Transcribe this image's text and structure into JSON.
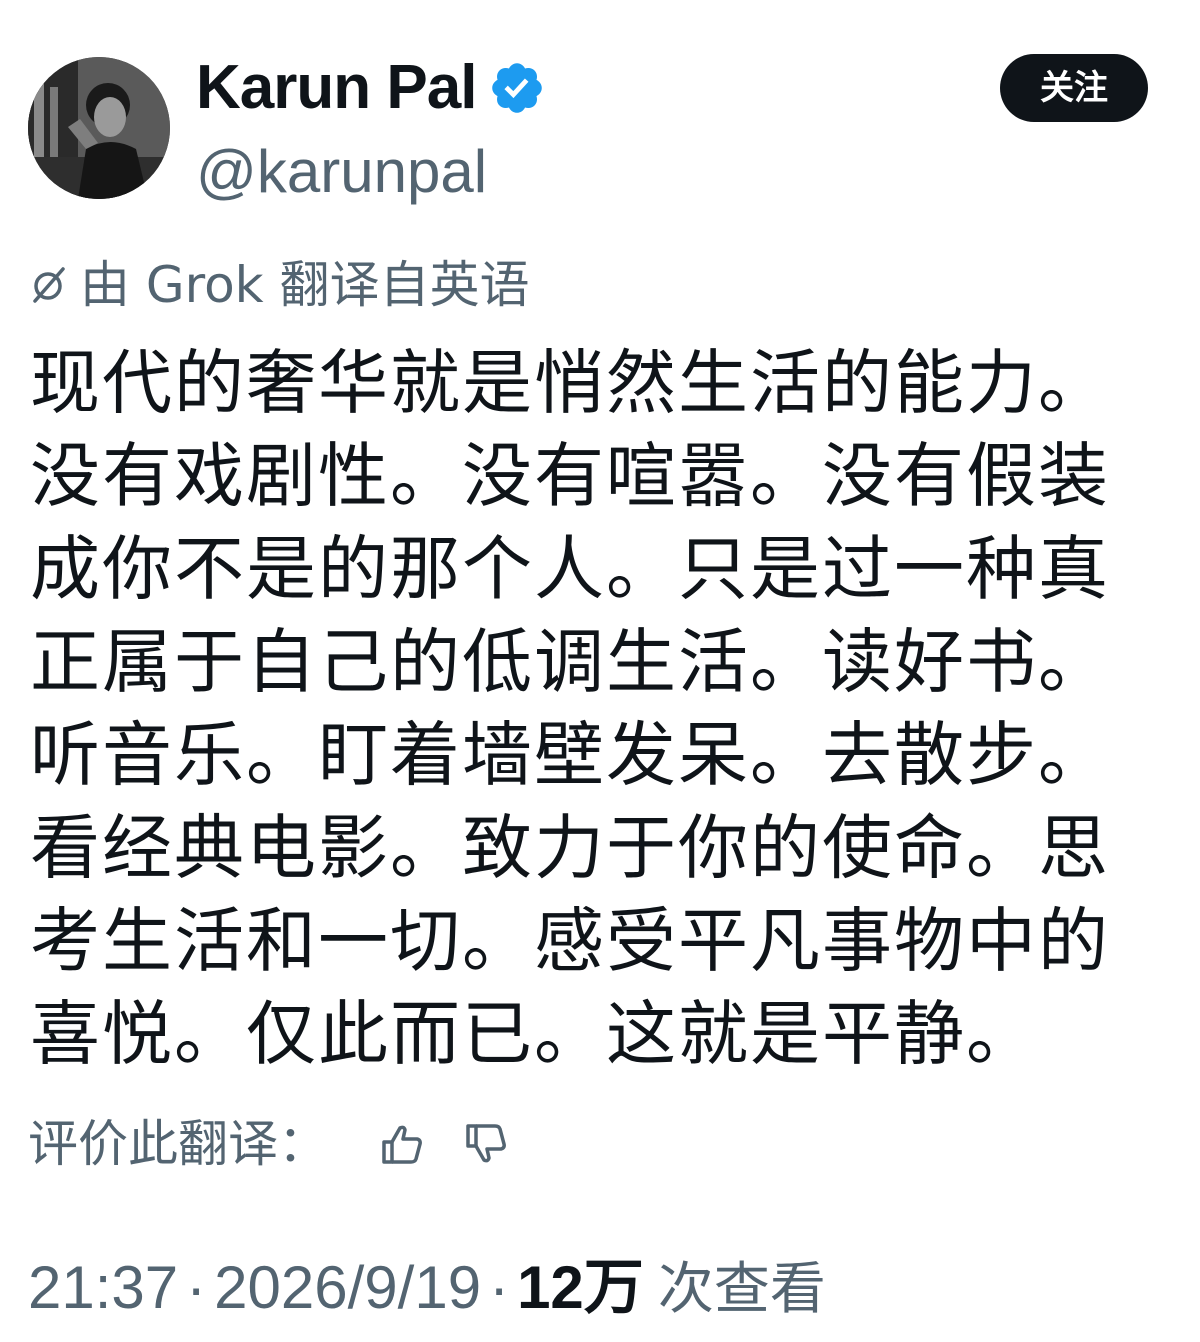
{
  "user": {
    "display_name": "Karun Pal",
    "handle": "@karunpal",
    "verified": true
  },
  "follow_button": {
    "label": "关注"
  },
  "translation": {
    "note": "由 Grok 翻译自英语",
    "icon": "grok-icon"
  },
  "tweet": {
    "text": "现代的奢华就是悄然生活的能力。没有戏剧性。没有喧嚣。没有假装成你不是的那个人。只是过一种真正属于自己的低调生活。读好书。听音乐。盯着墙壁发呆。去散步。看经典电影。致力于你的使命。思考生活和一切。感受平凡事物中的喜悦。仅此而已。这就是平静。"
  },
  "rate_translation": {
    "label": "评价此翻译：",
    "icons": [
      "thumbs-up-icon",
      "thumbs-down-icon"
    ]
  },
  "meta": {
    "time": "21:37",
    "separator": "·",
    "date": "2026/9/19",
    "views_count": "12万",
    "views_label": "次查看"
  },
  "colors": {
    "primary_text": "#0f1419",
    "secondary_text": "#536471",
    "verified_blue": "#1d9bf0",
    "button_bg": "#0f1419"
  }
}
